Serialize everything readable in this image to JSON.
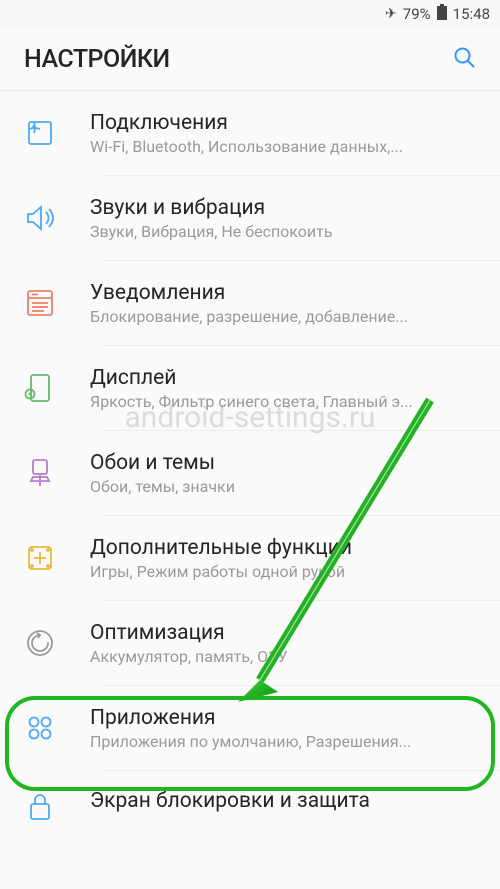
{
  "status_bar": {
    "battery_pct": "79%",
    "time": "15:48"
  },
  "header": {
    "title": "НАСТРОЙКИ"
  },
  "watermark": "android-settings.ru",
  "items": [
    {
      "title": "Подключения",
      "subtitle": "Wi-Fi, Bluetooth, Использование данных,..."
    },
    {
      "title": "Звуки и вибрация",
      "subtitle": "Звуки, Вибрация, Не беспокоить"
    },
    {
      "title": "Уведомления",
      "subtitle": "Блокирование, разрешение, добавление..."
    },
    {
      "title": "Дисплей",
      "subtitle": "Яркость, Фильтр синего света, Главный э..."
    },
    {
      "title": "Обои и темы",
      "subtitle": "Обои, темы, значки"
    },
    {
      "title": "Дополнительные функции",
      "subtitle": "Игры, Режим работы одной рукой"
    },
    {
      "title": "Оптимизация",
      "subtitle": "Аккумулятор, память, ОЗУ"
    },
    {
      "title": "Приложения",
      "subtitle": "Приложения по умолчанию, Разрешения..."
    },
    {
      "title": "Экран блокировки и защита",
      "subtitle": ""
    }
  ]
}
